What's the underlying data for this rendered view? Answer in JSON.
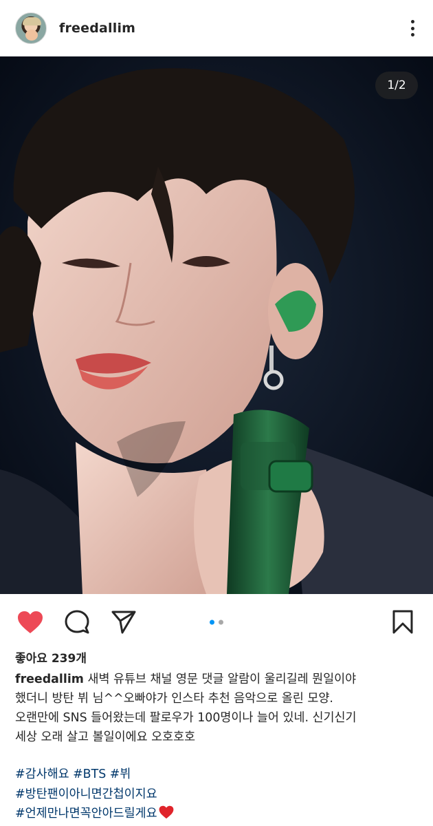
{
  "header": {
    "username": "freedallim",
    "avatar_icon": "profile-avatar",
    "more_icon": "more-options-icon"
  },
  "post": {
    "carousel_counter": "1/2",
    "carousel_position": {
      "current": 1,
      "total": 2
    }
  },
  "actions": {
    "like_icon": "heart-icon",
    "liked": true,
    "like_color": "#ed4956",
    "comment_icon": "comment-icon",
    "share_icon": "send-icon",
    "save_icon": "bookmark-icon",
    "indicator_active_color": "#0095f6"
  },
  "likes": {
    "text": "좋아요 239개"
  },
  "caption": {
    "username": "freedallim",
    "lines": [
      "새벽 유튜브 채널 영문 댓글 알람이 울리길레 뭔일이야",
      "했더니 방탄 뷔 님^^오빠야가 인스타 추천 음악으로 올린 모양.",
      "오랜만에 SNS 들어왔는데 팔로우가 100명이나 늘어 있네. 신기신기",
      "세상 오래 살고 볼일이에요 오호호호"
    ],
    "hashtags": [
      "#감사해요 #BTS #뷔",
      "#방탄팬이아니면간첩이지요",
      "#언제만나면꼭안아드릴게요"
    ],
    "end_emoji": "red-heart-emoji",
    "hashtag_color": "#00376b"
  }
}
